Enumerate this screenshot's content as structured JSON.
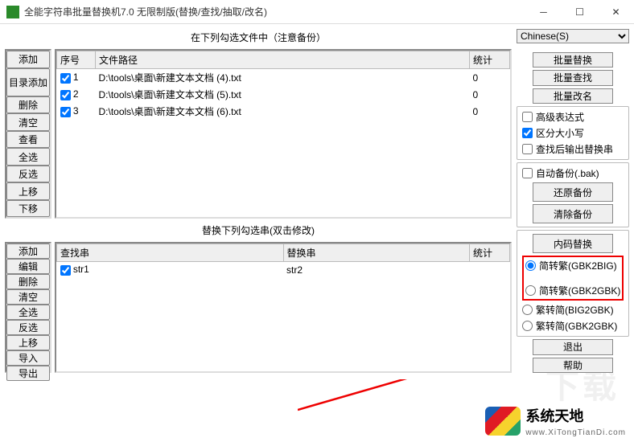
{
  "window": {
    "title": "全能字符串批量替换机7.0 无限制版(替换/查找/抽取/改名)"
  },
  "top_section": {
    "label": "在下列勾选文件中（注意备份）",
    "buttons": [
      "添加",
      "目录添加",
      "删除",
      "清空",
      "查看",
      "全选",
      "反选",
      "上移",
      "下移"
    ],
    "headers": {
      "seq": "序号",
      "path": "文件路径",
      "stat": "统计"
    },
    "rows": [
      {
        "seq": "1",
        "checked": true,
        "path": "D:\\tools\\桌面\\新建文本文档 (4).txt",
        "stat": "0"
      },
      {
        "seq": "2",
        "checked": true,
        "path": "D:\\tools\\桌面\\新建文本文档 (5).txt",
        "stat": "0"
      },
      {
        "seq": "3",
        "checked": true,
        "path": "D:\\tools\\桌面\\新建文本文档 (6).txt",
        "stat": "0"
      }
    ]
  },
  "bottom_section": {
    "label": "替换下列勾选串(双击修改)",
    "buttons": [
      "添加",
      "编辑",
      "删除",
      "清空",
      "全选",
      "反选",
      "上移",
      "导入",
      "导出"
    ],
    "headers": {
      "find": "查找串",
      "replace": "替换串",
      "stat": "统计"
    },
    "rows": [
      {
        "checked": true,
        "find": "str1",
        "replace": "str2",
        "stat": ""
      }
    ]
  },
  "right_panel": {
    "encoding": "Chinese(S)",
    "batch_replace": "批量替换",
    "batch_find": "批量查找",
    "batch_rename": "批量改名",
    "adv_expr": "高级表达式",
    "case_sensitive": "区分大小写",
    "output_after_find": "查找后输出替换串",
    "auto_backup": "自动备份(.bak)",
    "restore_backup": "还原备份",
    "clear_backup": "清除备份",
    "code_replace": "内码替换",
    "s2t_gbk2big": "简转繁(GBK2BIG)",
    "s2t_gbk2gbk": "简转繁(GBK2GBK)",
    "t2s_big2gbk": "繁转简(BIG2GBK)",
    "t2s_gbk2gbk": "繁转简(GBK2GBK)",
    "exit": "退出",
    "help": "帮助"
  },
  "watermark": {
    "name": "系统天地",
    "url": "www.XiTongTianDi.com",
    "bg": "下载"
  }
}
